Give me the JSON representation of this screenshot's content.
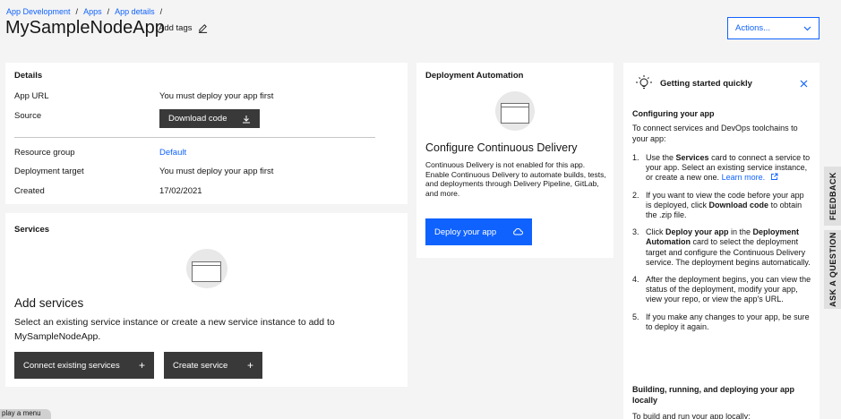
{
  "breadcrumb": [
    "App Development",
    "Apps",
    "App details"
  ],
  "title": "MySampleNodeApp",
  "add_tags": "Add tags",
  "actions_label": "Actions...",
  "details": {
    "heading": "Details",
    "app_url_label": "App URL",
    "app_url_value": "You must deploy your app first",
    "source_label": "Source",
    "download_label": "Download code",
    "resource_group_label": "Resource group",
    "resource_group_value": "Default",
    "deployment_target_label": "Deployment target",
    "deployment_target_value": "You must deploy your app first",
    "created_label": "Created",
    "created_value": "17/02/2021"
  },
  "services": {
    "heading": "Services",
    "subtitle": "Add services",
    "description_line1": "Select an existing service instance or create a new service instance to add to",
    "description_line2": "MySampleNodeApp.",
    "connect_label": "Connect existing services",
    "create_label": "Create service"
  },
  "automation": {
    "heading": "Deployment Automation",
    "subtitle": "Configure Continuous Delivery",
    "description": "Continuous Delivery is not enabled for this app. Enable Continuous Delivery to automate builds, tests, and deployments through Delivery Pipeline, GitLab, and more.",
    "deploy_label": "Deploy your app"
  },
  "getting_started": {
    "heading": "Getting started quickly",
    "section1": "Configuring your app",
    "intro": "To connect services and DevOps toolchains to your app:",
    "steps": [
      {
        "num": "1.",
        "pre": "Use the ",
        "b1": "Services",
        "mid": " card to connect a service to your app. Select an existing service instance, or create a new one. ",
        "link": "Learn more."
      },
      {
        "num": "2.",
        "pre": "If you want to view the code before your app is deployed, click ",
        "b1": "Download code",
        "mid": " to obtain the .zip file."
      },
      {
        "num": "3.",
        "pre": "Click ",
        "b1": "Deploy your app",
        "mid": " in the ",
        "b2": "Deployment Automation",
        "post": " card to select the deployment target and configure the Continuous Delivery service. The deployment begins automatically."
      },
      {
        "num": "4.",
        "pre": "After the deployment begins, you can view the status of the deployment, modify your app, view your repo, or view the app's URL."
      },
      {
        "num": "5.",
        "pre": "If you make any changes to your app, be sure to deploy it again."
      }
    ],
    "section2": "Building, running, and deploying your app locally",
    "cut_text": "To build and run your app locally:"
  },
  "side_tabs": {
    "feedback": "FEEDBACK",
    "ask": "ASK A QUESTION"
  },
  "tooltip": "play a menu",
  "colors": {
    "accent": "#0f62fe",
    "dark_button": "#393939",
    "background": "#f4f4f4"
  },
  "icons": [
    "edit-icon",
    "chevron-down-icon",
    "download-icon",
    "plus-icon",
    "cloud-icon",
    "lightbulb-icon",
    "close-icon",
    "launch-icon"
  ]
}
